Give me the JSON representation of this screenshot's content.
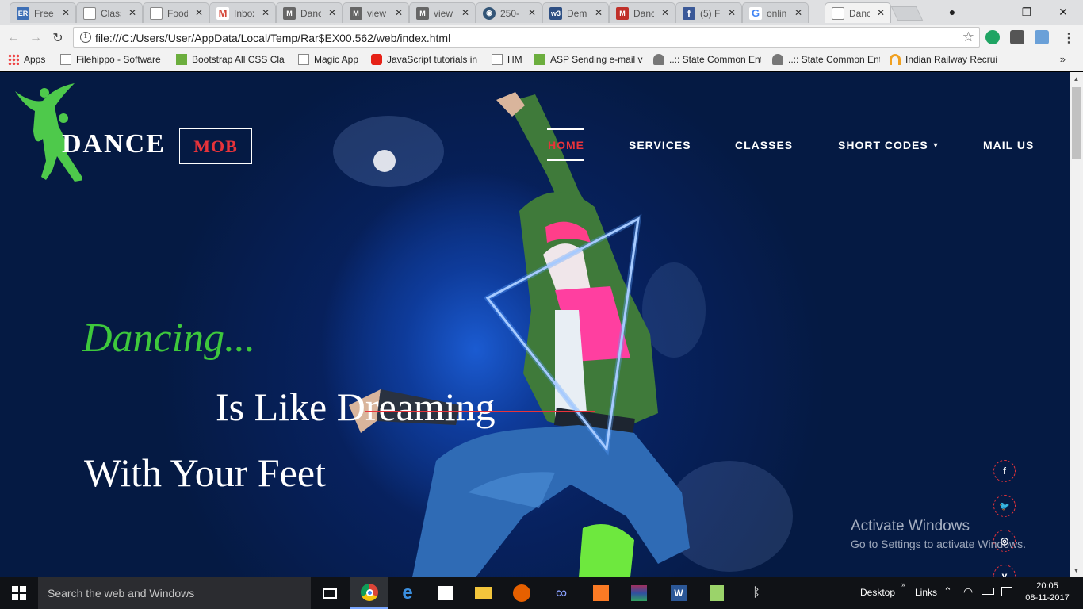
{
  "browser": {
    "tabs": [
      {
        "label": "Free",
        "icon": "er-icon",
        "color": "#3d6fb6"
      },
      {
        "label": "Class",
        "icon": "page-icon",
        "color": "#888888"
      },
      {
        "label": "Food",
        "icon": "page-icon",
        "color": "#888888"
      },
      {
        "label": "Inbox",
        "icon": "gmail-icon",
        "color": "#d44638"
      },
      {
        "label": "Danc",
        "icon": "template-icon",
        "color": "#666666"
      },
      {
        "label": "view",
        "icon": "template-icon",
        "color": "#666666"
      },
      {
        "label": "view",
        "icon": "template-icon",
        "color": "#666666"
      },
      {
        "label": "250-",
        "icon": "globe-icon",
        "color": "#335577"
      },
      {
        "label": "Dem",
        "icon": "w3-icon",
        "color": "#2e4f83"
      },
      {
        "label": "Danc",
        "icon": "template-icon",
        "color": "#c0302a"
      },
      {
        "label": "(5) F",
        "icon": "facebook-icon",
        "color": "#3b5998"
      },
      {
        "label": "onlin",
        "icon": "google-icon",
        "color": "#4285f4"
      },
      {
        "label": "Danc",
        "icon": "page-icon",
        "color": "#888888"
      }
    ],
    "active_tab": 12,
    "url": "file:///C:/Users/User/AppData/Local/Temp/Rar$EX00.562/web/index.html",
    "bookmarks": [
      {
        "label": "Apps",
        "icon": "apps-grid-icon"
      },
      {
        "label": "Filehippo - Software",
        "icon": "page-icon"
      },
      {
        "label": "Bootstrap All CSS Cla",
        "icon": "w3layouts-icon"
      },
      {
        "label": "Magic App",
        "icon": "page-icon"
      },
      {
        "label": "JavaScript tutorials in",
        "icon": "youtube-icon"
      },
      {
        "label": "HM",
        "icon": "page-icon"
      },
      {
        "label": "ASP Sending e-mail v",
        "icon": "w3layouts-icon"
      },
      {
        "label": "..:: State Common Ent",
        "icon": "emblem-icon"
      },
      {
        "label": "..:: State Common Ent",
        "icon": "emblem-icon"
      },
      {
        "label": "Indian Railway Recrui",
        "icon": "railway-icon"
      }
    ],
    "bookmarks_more": "»"
  },
  "site": {
    "logo": {
      "word": "DANCE",
      "box": "MOB"
    },
    "nav": [
      {
        "label": "HOME",
        "active": true
      },
      {
        "label": "SERVICES",
        "active": false
      },
      {
        "label": "CLASSES",
        "active": false
      },
      {
        "label": "SHORT CODES",
        "active": false,
        "has_dropdown": true
      },
      {
        "label": "MAIL US",
        "active": false
      }
    ],
    "hero": {
      "line1": "Dancing...",
      "line2": "Is Like Dreaming",
      "line3": "With Your Feet"
    },
    "social": [
      {
        "icon": "facebook-icon",
        "glyph": "f"
      },
      {
        "icon": "twitter-icon",
        "glyph": "🐦"
      },
      {
        "icon": "dribbble-icon",
        "glyph": "◎"
      },
      {
        "icon": "vimeo-icon",
        "glyph": "v"
      }
    ],
    "colors": {
      "accent_red": "#e8333a",
      "accent_green": "#3ec83c",
      "bg_navy": "#07215e"
    }
  },
  "os": {
    "watermark_title": "Activate Windows",
    "watermark_sub": "Go to Settings to activate Windows.",
    "search_placeholder": "Search the web and Windows",
    "tray_desktop": "Desktop",
    "tray_links": "Links",
    "time": "20:05",
    "date": "08-11-2017"
  }
}
